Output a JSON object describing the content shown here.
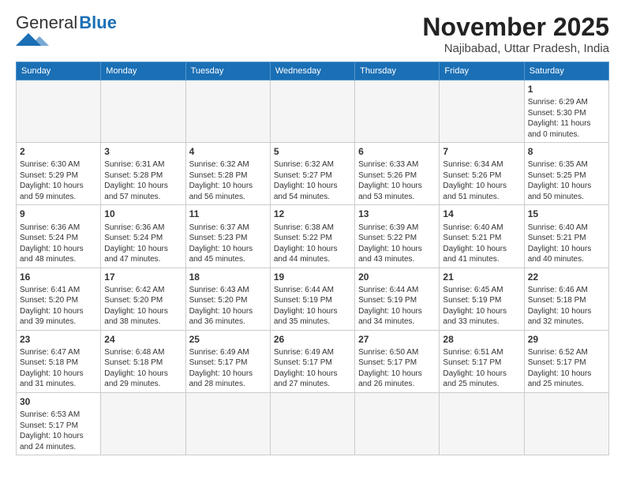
{
  "header": {
    "logo_general": "General",
    "logo_blue": "Blue",
    "title": "November 2025",
    "location": "Najibabad, Uttar Pradesh, India"
  },
  "days_of_week": [
    "Sunday",
    "Monday",
    "Tuesday",
    "Wednesday",
    "Thursday",
    "Friday",
    "Saturday"
  ],
  "weeks": [
    [
      {
        "day": "",
        "info": ""
      },
      {
        "day": "",
        "info": ""
      },
      {
        "day": "",
        "info": ""
      },
      {
        "day": "",
        "info": ""
      },
      {
        "day": "",
        "info": ""
      },
      {
        "day": "",
        "info": ""
      },
      {
        "day": "1",
        "info": "Sunrise: 6:29 AM\nSunset: 5:30 PM\nDaylight: 11 hours\nand 0 minutes."
      }
    ],
    [
      {
        "day": "2",
        "info": "Sunrise: 6:30 AM\nSunset: 5:29 PM\nDaylight: 10 hours\nand 59 minutes."
      },
      {
        "day": "3",
        "info": "Sunrise: 6:31 AM\nSunset: 5:28 PM\nDaylight: 10 hours\nand 57 minutes."
      },
      {
        "day": "4",
        "info": "Sunrise: 6:32 AM\nSunset: 5:28 PM\nDaylight: 10 hours\nand 56 minutes."
      },
      {
        "day": "5",
        "info": "Sunrise: 6:32 AM\nSunset: 5:27 PM\nDaylight: 10 hours\nand 54 minutes."
      },
      {
        "day": "6",
        "info": "Sunrise: 6:33 AM\nSunset: 5:26 PM\nDaylight: 10 hours\nand 53 minutes."
      },
      {
        "day": "7",
        "info": "Sunrise: 6:34 AM\nSunset: 5:26 PM\nDaylight: 10 hours\nand 51 minutes."
      },
      {
        "day": "8",
        "info": "Sunrise: 6:35 AM\nSunset: 5:25 PM\nDaylight: 10 hours\nand 50 minutes."
      }
    ],
    [
      {
        "day": "9",
        "info": "Sunrise: 6:36 AM\nSunset: 5:24 PM\nDaylight: 10 hours\nand 48 minutes."
      },
      {
        "day": "10",
        "info": "Sunrise: 6:36 AM\nSunset: 5:24 PM\nDaylight: 10 hours\nand 47 minutes."
      },
      {
        "day": "11",
        "info": "Sunrise: 6:37 AM\nSunset: 5:23 PM\nDaylight: 10 hours\nand 45 minutes."
      },
      {
        "day": "12",
        "info": "Sunrise: 6:38 AM\nSunset: 5:22 PM\nDaylight: 10 hours\nand 44 minutes."
      },
      {
        "day": "13",
        "info": "Sunrise: 6:39 AM\nSunset: 5:22 PM\nDaylight: 10 hours\nand 43 minutes."
      },
      {
        "day": "14",
        "info": "Sunrise: 6:40 AM\nSunset: 5:21 PM\nDaylight: 10 hours\nand 41 minutes."
      },
      {
        "day": "15",
        "info": "Sunrise: 6:40 AM\nSunset: 5:21 PM\nDaylight: 10 hours\nand 40 minutes."
      }
    ],
    [
      {
        "day": "16",
        "info": "Sunrise: 6:41 AM\nSunset: 5:20 PM\nDaylight: 10 hours\nand 39 minutes."
      },
      {
        "day": "17",
        "info": "Sunrise: 6:42 AM\nSunset: 5:20 PM\nDaylight: 10 hours\nand 38 minutes."
      },
      {
        "day": "18",
        "info": "Sunrise: 6:43 AM\nSunset: 5:20 PM\nDaylight: 10 hours\nand 36 minutes."
      },
      {
        "day": "19",
        "info": "Sunrise: 6:44 AM\nSunset: 5:19 PM\nDaylight: 10 hours\nand 35 minutes."
      },
      {
        "day": "20",
        "info": "Sunrise: 6:44 AM\nSunset: 5:19 PM\nDaylight: 10 hours\nand 34 minutes."
      },
      {
        "day": "21",
        "info": "Sunrise: 6:45 AM\nSunset: 5:19 PM\nDaylight: 10 hours\nand 33 minutes."
      },
      {
        "day": "22",
        "info": "Sunrise: 6:46 AM\nSunset: 5:18 PM\nDaylight: 10 hours\nand 32 minutes."
      }
    ],
    [
      {
        "day": "23",
        "info": "Sunrise: 6:47 AM\nSunset: 5:18 PM\nDaylight: 10 hours\nand 31 minutes."
      },
      {
        "day": "24",
        "info": "Sunrise: 6:48 AM\nSunset: 5:18 PM\nDaylight: 10 hours\nand 29 minutes."
      },
      {
        "day": "25",
        "info": "Sunrise: 6:49 AM\nSunset: 5:17 PM\nDaylight: 10 hours\nand 28 minutes."
      },
      {
        "day": "26",
        "info": "Sunrise: 6:49 AM\nSunset: 5:17 PM\nDaylight: 10 hours\nand 27 minutes."
      },
      {
        "day": "27",
        "info": "Sunrise: 6:50 AM\nSunset: 5:17 PM\nDaylight: 10 hours\nand 26 minutes."
      },
      {
        "day": "28",
        "info": "Sunrise: 6:51 AM\nSunset: 5:17 PM\nDaylight: 10 hours\nand 25 minutes."
      },
      {
        "day": "29",
        "info": "Sunrise: 6:52 AM\nSunset: 5:17 PM\nDaylight: 10 hours\nand 25 minutes."
      }
    ],
    [
      {
        "day": "30",
        "info": "Sunrise: 6:53 AM\nSunset: 5:17 PM\nDaylight: 10 hours\nand 24 minutes."
      },
      {
        "day": "",
        "info": ""
      },
      {
        "day": "",
        "info": ""
      },
      {
        "day": "",
        "info": ""
      },
      {
        "day": "",
        "info": ""
      },
      {
        "day": "",
        "info": ""
      },
      {
        "day": "",
        "info": ""
      }
    ]
  ]
}
